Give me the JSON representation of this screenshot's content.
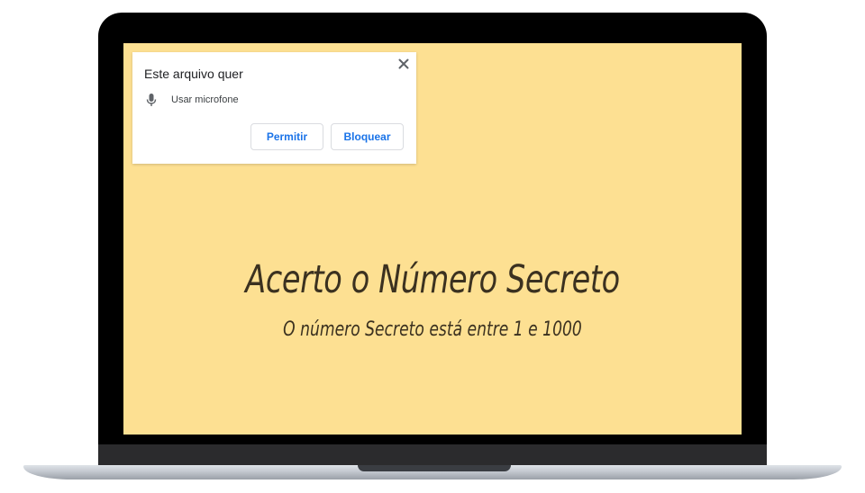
{
  "permission_popup": {
    "title": "Este arquivo quer",
    "permission_label": "Usar microfone",
    "permission_icon": "microphone-icon",
    "close_icon": "close-icon",
    "allow_label": "Permitir",
    "block_label": "Bloquear"
  },
  "page": {
    "heading": "Acerto o Número Secreto",
    "subheading": "O número Secreto está entre 1 e 1000",
    "background_color": "#fde092",
    "text_color": "#3b3120"
  },
  "colors": {
    "button_text": "#1a73e8"
  }
}
